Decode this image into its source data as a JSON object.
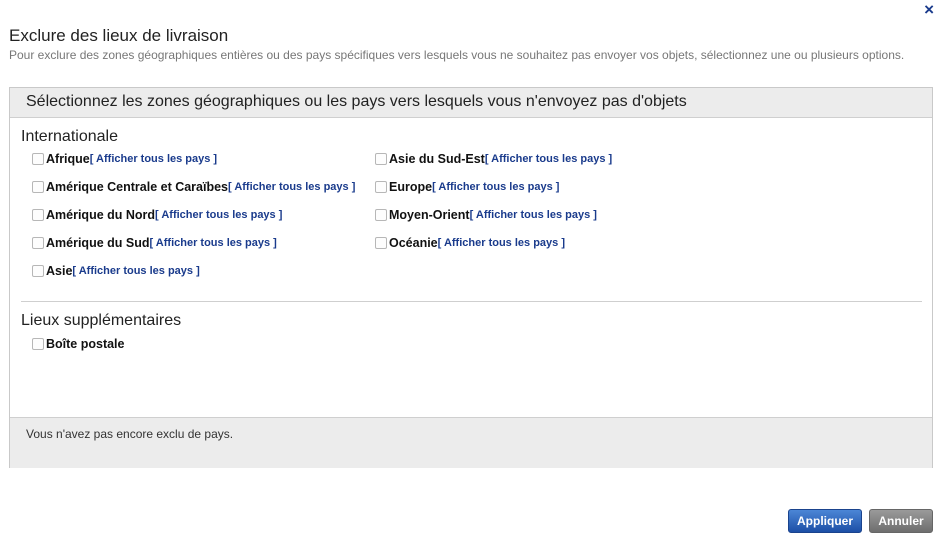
{
  "dialog": {
    "title": "Exclure des lieux de livraison",
    "subtitle": "Pour exclure des zones géographiques entières ou des pays spécifiques vers lesquels vous ne souhaitez pas envoyer vos objets, sélectionnez une ou plusieurs options.",
    "close_label": "×"
  },
  "panel": {
    "heading": "Sélectionnez les zones géographiques ou les pays vers lesquels vous n'envoyez pas d'objets"
  },
  "international": {
    "label": "Internationale",
    "left": [
      {
        "name": "Afrique",
        "link": "[ Afficher tous les pays ]",
        "checked": false
      },
      {
        "name": "Amérique Centrale et Caraïbes",
        "link": "[ Afficher tous les pays ]",
        "checked": false
      },
      {
        "name": "Amérique du Nord",
        "link": "[ Afficher tous les pays ]",
        "checked": false
      },
      {
        "name": "Amérique du Sud",
        "link": "[ Afficher tous les pays ]",
        "checked": false
      },
      {
        "name": "Asie",
        "link": "[ Afficher tous les pays ]",
        "checked": false
      }
    ],
    "right": [
      {
        "name": "Asie du Sud-Est",
        "link": "[ Afficher tous les pays ]",
        "checked": false
      },
      {
        "name": "Europe",
        "link": "[ Afficher tous les pays ]",
        "checked": false
      },
      {
        "name": "Moyen-Orient",
        "link": "[ Afficher tous les pays ]",
        "checked": false
      },
      {
        "name": "Océanie",
        "link": "[ Afficher tous les pays ]",
        "checked": false
      }
    ]
  },
  "additional": {
    "label": "Lieux supplémentaires",
    "items": [
      {
        "name": "Boîte postale",
        "checked": false
      }
    ]
  },
  "status": {
    "text": "Vous n'avez pas encore exclu de pays."
  },
  "buttons": {
    "apply": "Appliquer",
    "cancel": "Annuler"
  },
  "colors": {
    "link": "#1a3b8c",
    "apply_button": "#2a5cb3",
    "cancel_button": "#7d7d7d",
    "panel_header": "#ececec"
  }
}
